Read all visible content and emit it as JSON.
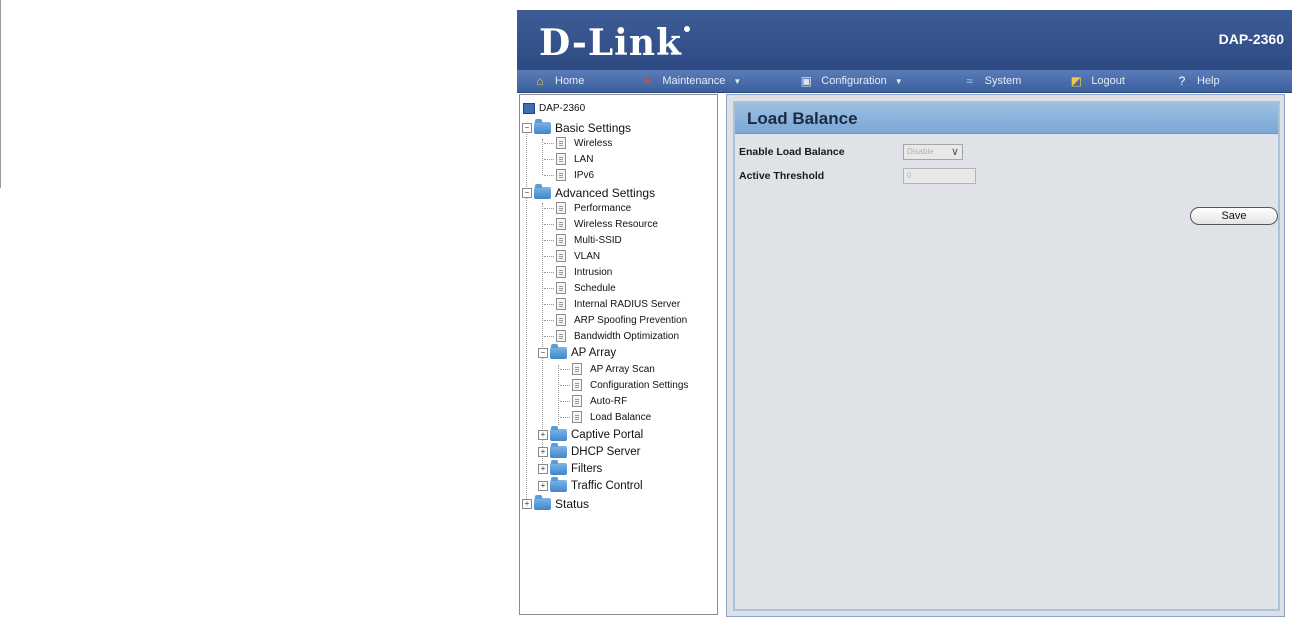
{
  "header": {
    "brand": "D-Link",
    "model": "DAP-2360"
  },
  "nav": [
    {
      "label": "Home",
      "icon": "home-icon",
      "dropdown": false
    },
    {
      "label": "Maintenance",
      "icon": "tools-icon",
      "dropdown": true
    },
    {
      "label": "Configuration",
      "icon": "disk-icon",
      "dropdown": true
    },
    {
      "label": "System",
      "icon": "system-icon",
      "dropdown": false
    },
    {
      "label": "Logout",
      "icon": "logout-icon",
      "dropdown": false
    },
    {
      "label": "Help",
      "icon": "help-icon",
      "dropdown": false
    }
  ],
  "tree": {
    "root": "DAP-2360",
    "basic_settings": "Basic Settings",
    "wireless": "Wireless",
    "lan": "LAN",
    "ipv6": "IPv6",
    "advanced_settings": "Advanced Settings",
    "performance": "Performance",
    "wireless_resource": "Wireless Resource",
    "multi_ssid": "Multi-SSID",
    "vlan": "VLAN",
    "intrusion": "Intrusion",
    "schedule": "Schedule",
    "internal_radius": "Internal RADIUS Server",
    "arp_spoofing": "ARP Spoofing Prevention",
    "bandwidth_opt": "Bandwidth Optimization",
    "ap_array": "AP Array",
    "ap_array_scan": "AP Array Scan",
    "configuration_settings": "Configuration Settings",
    "auto_rf": "Auto-RF",
    "load_balance": "Load Balance",
    "captive_portal": "Captive Portal",
    "dhcp_server": "DHCP Server",
    "filters": "Filters",
    "traffic_control": "Traffic Control",
    "status": "Status"
  },
  "main": {
    "title": "Load Balance",
    "enable_label": "Enable Load Balance",
    "enable_value": "Disable",
    "threshold_label": "Active Threshold",
    "threshold_value": "0",
    "save_label": "Save"
  },
  "colors": {
    "header": "#2e4a83",
    "nav": "#4a6dad",
    "panel_title": "#8cb4de",
    "content_bg": "#dfe2e6"
  }
}
